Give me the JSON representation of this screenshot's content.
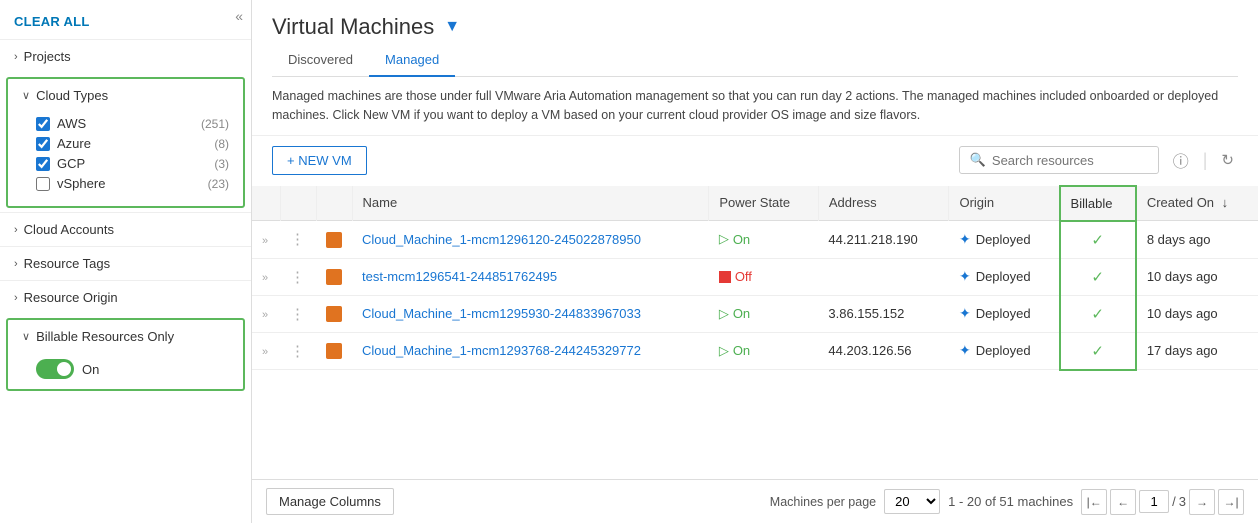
{
  "sidebar": {
    "collapse_label": "«",
    "clear_all": "CLEAR ALL",
    "sections": [
      {
        "id": "projects",
        "label": "Projects",
        "expanded": false
      },
      {
        "id": "cloud-types",
        "label": "Cloud Types",
        "expanded": true,
        "items": [
          {
            "id": "aws",
            "label": "AWS",
            "count": "(251)",
            "checked": true
          },
          {
            "id": "azure",
            "label": "Azure",
            "count": "(8)",
            "checked": true
          },
          {
            "id": "gcp",
            "label": "GCP",
            "count": "(3)",
            "checked": true
          },
          {
            "id": "vsphere",
            "label": "vSphere",
            "count": "(23)",
            "checked": false
          }
        ]
      },
      {
        "id": "cloud-accounts",
        "label": "Cloud Accounts",
        "expanded": false
      },
      {
        "id": "resource-tags",
        "label": "Resource Tags",
        "expanded": false
      },
      {
        "id": "resource-origin",
        "label": "Resource Origin",
        "expanded": false
      },
      {
        "id": "billable-resources",
        "label": "Billable Resources Only",
        "expanded": true,
        "toggle": true,
        "toggle_on": true,
        "toggle_label": "On"
      }
    ]
  },
  "page": {
    "title": "Virtual Machines",
    "filter_icon": "▼",
    "tabs": [
      {
        "id": "discovered",
        "label": "Discovered",
        "active": false
      },
      {
        "id": "managed",
        "label": "Managed",
        "active": true
      }
    ],
    "description": "Managed machines are those under full VMware Aria Automation management so that you can run day 2 actions. The managed machines included onboarded or deployed machines. Click New VM if you want to deploy a VM based on your current cloud provider OS image and size flavors.",
    "toolbar": {
      "new_vm": "+ NEW VM",
      "search_placeholder": "Search resources"
    },
    "table": {
      "columns": [
        {
          "id": "expand",
          "label": ""
        },
        {
          "id": "actions",
          "label": ""
        },
        {
          "id": "icon",
          "label": ""
        },
        {
          "id": "name",
          "label": "Name"
        },
        {
          "id": "power-state",
          "label": "Power State"
        },
        {
          "id": "address",
          "label": "Address"
        },
        {
          "id": "origin",
          "label": "Origin"
        },
        {
          "id": "billable",
          "label": "Billable"
        },
        {
          "id": "created-on",
          "label": "Created On",
          "sort": true
        }
      ],
      "rows": [
        {
          "name": "Cloud_Machine_1-mcm1296120-245022878950",
          "power_state": "On",
          "power_on": true,
          "address": "44.211.218.190",
          "origin": "Deployed",
          "billable": true,
          "created_on": "8 days ago"
        },
        {
          "name": "test-mcm1296541-244851762495",
          "power_state": "Off",
          "power_on": false,
          "address": "",
          "origin": "Deployed",
          "billable": true,
          "created_on": "10 days ago"
        },
        {
          "name": "Cloud_Machine_1-mcm1295930-244833967033",
          "power_state": "On",
          "power_on": true,
          "address": "3.86.155.152",
          "origin": "Deployed",
          "billable": true,
          "created_on": "10 days ago"
        },
        {
          "name": "Cloud_Machine_1-mcm1293768-244245329772",
          "power_state": "On",
          "power_on": true,
          "address": "44.203.126.56",
          "origin": "Deployed",
          "billable": true,
          "created_on": "17 days ago"
        }
      ]
    },
    "footer": {
      "manage_columns": "Manage Columns",
      "machines_per_page": "Machines per page",
      "per_page": "20",
      "range": "1 - 20 of 51 machines",
      "current_page": "1",
      "total_pages": "3"
    }
  }
}
